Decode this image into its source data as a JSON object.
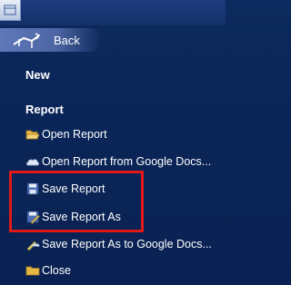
{
  "nav": {
    "back_label": "Back"
  },
  "sections": {
    "new_heading": "New",
    "report_heading": "Report"
  },
  "items": {
    "open_report": "Open Report",
    "open_report_google": "Open Report from Google Docs...",
    "save_report": "Save Report",
    "save_report_as": "Save Report As",
    "save_report_google": "Save Report As to Google Docs...",
    "close": "Close"
  },
  "highlight_color": "#e01818"
}
